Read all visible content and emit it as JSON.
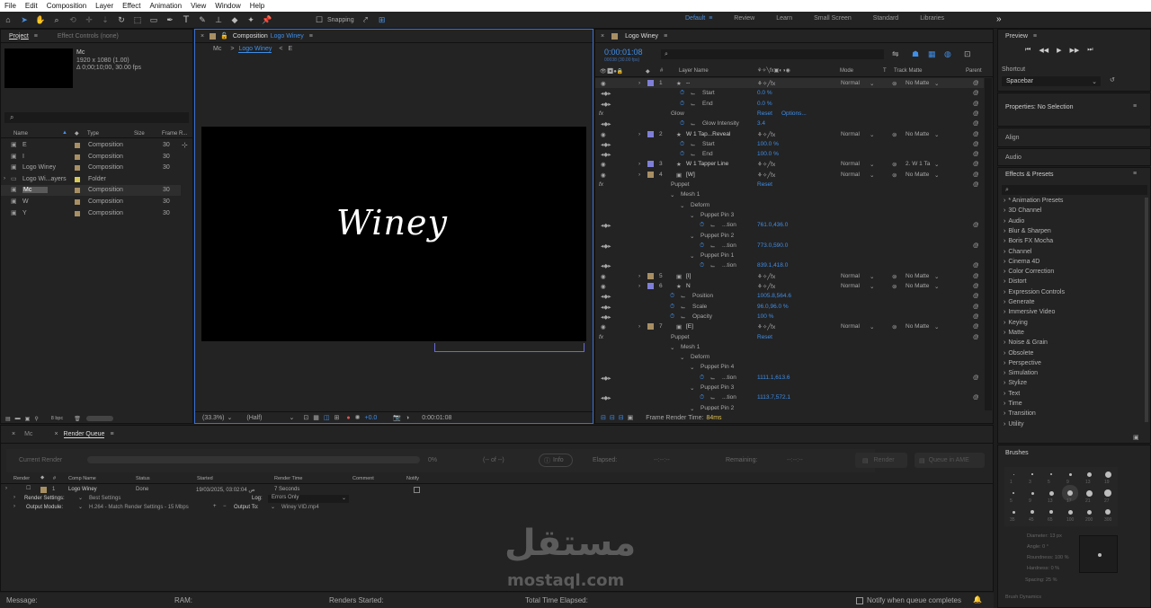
{
  "menu": [
    "File",
    "Edit",
    "Composition",
    "Layer",
    "Effect",
    "Animation",
    "View",
    "Window",
    "Help"
  ],
  "toolbar": {
    "snapping": "Snapping",
    "workspaces": [
      "Default",
      "Review",
      "Learn",
      "Small Screen",
      "Standard",
      "Libraries"
    ],
    "more": "»"
  },
  "project": {
    "tab": "Project",
    "tab_menu": "≡",
    "effect_controls": "Effect Controls (none)",
    "item_name": "Mc",
    "item_size": "1920 x 1080 (1.00)",
    "item_duration": "Δ 0;00;10;00, 30.00 fps",
    "search_icon": "⌕",
    "columns": [
      "Name",
      "Type",
      "Size",
      "Frame R..."
    ],
    "items": [
      {
        "name": "E",
        "type": "Composition",
        "fps": "30"
      },
      {
        "name": "I",
        "type": "Composition",
        "fps": "30"
      },
      {
        "name": "Logo Winey",
        "type": "Composition",
        "fps": "30"
      },
      {
        "name": "Logo Wi...ayers",
        "type": "Folder",
        "fps": ""
      },
      {
        "name": "Mc",
        "type": "Composition",
        "fps": "30"
      },
      {
        "name": "W",
        "type": "Composition",
        "fps": "30"
      },
      {
        "name": "Y",
        "type": "Composition",
        "fps": "30"
      }
    ],
    "bpc": "8 bpc"
  },
  "comp": {
    "tab_label": "Composition",
    "tab_name": "Logo Winey",
    "breadcrumb": [
      "Mc",
      "Logo Winey",
      "E"
    ],
    "logo_text": "Winey",
    "zoom": "(33.3%)",
    "quality": "(Half)",
    "exposure": "+0.0",
    "timecode": "0:00:01:08"
  },
  "timeline": {
    "tab": "Logo Winey",
    "time": "0:00:01:08",
    "frames": "00038 (30.00 fps)",
    "cols": [
      "#",
      "Layer Name",
      "Mode",
      "T",
      "Track Matte",
      "Parent"
    ],
    "render_time_label": "Frame Render Time:",
    "render_time_value": "84ms",
    "rows": [
      {
        "k": "layer",
        "num": "1",
        "name": "--",
        "mode": "Normal",
        "matte": "No Matte",
        "color": "#7f7fd8",
        "sel": true
      },
      {
        "k": "prop",
        "name": "Start",
        "val": "0.0 %",
        "ind": 2
      },
      {
        "k": "prop",
        "name": "End",
        "val": "0.0 %",
        "ind": 2
      },
      {
        "k": "fx",
        "name": "Glow",
        "val": "Reset",
        "extra": "Options..."
      },
      {
        "k": "prop",
        "name": "Glow Intensity",
        "val": "3.4",
        "ind": 2
      },
      {
        "k": "layer",
        "num": "2",
        "name": "W 1 Tap...Reveal",
        "mode": "Normal",
        "matte": "No Matte",
        "color": "#7f7fd8",
        "sel": false
      },
      {
        "k": "prop",
        "name": "Start",
        "val": "100.0 %",
        "ind": 2
      },
      {
        "k": "prop",
        "name": "End",
        "val": "100.0 %",
        "ind": 2
      },
      {
        "k": "layer",
        "num": "3",
        "name": "W 1 Tapper Line",
        "mode": "Normal",
        "matte": "2. W 1 Ta",
        "color": "#7f7fd8",
        "sel": false
      },
      {
        "k": "layer",
        "num": "4",
        "name": "[W]",
        "mode": "Normal",
        "matte": "No Matte",
        "color": "#a88f63",
        "sel": false
      },
      {
        "k": "fx",
        "name": "Puppet",
        "val": "Reset"
      },
      {
        "k": "group",
        "name": "Mesh 1",
        "ind": 1
      },
      {
        "k": "group",
        "name": "Deform",
        "ind": 2
      },
      {
        "k": "group",
        "name": "Puppet Pin 3",
        "ind": 3
      },
      {
        "k": "prop",
        "name": "...tion",
        "val": "761.0,436.0",
        "ind": 4
      },
      {
        "k": "group",
        "name": "Puppet Pin 2",
        "ind": 3
      },
      {
        "k": "prop",
        "name": "...tion",
        "val": "773.0,590.0",
        "ind": 4
      },
      {
        "k": "group",
        "name": "Puppet Pin 1",
        "ind": 3
      },
      {
        "k": "prop",
        "name": "...tion",
        "val": "839.1,418.0",
        "ind": 4
      },
      {
        "k": "layer",
        "num": "5",
        "name": "[I]",
        "mode": "Normal",
        "matte": "No Matte",
        "color": "#a88f63",
        "sel": false
      },
      {
        "k": "layer",
        "num": "6",
        "name": "N",
        "mode": "Normal",
        "matte": "No Matte",
        "color": "#7f7fd8",
        "sel": false
      },
      {
        "k": "prop",
        "name": "Position",
        "val": "1005.8,564.6",
        "ind": 1
      },
      {
        "k": "prop",
        "name": "Scale",
        "val": "96.0,96.0 %",
        "ind": 1
      },
      {
        "k": "prop",
        "name": "Opacity",
        "val": "100 %",
        "ind": 1
      },
      {
        "k": "layer",
        "num": "7",
        "name": "[E]",
        "mode": "Normal",
        "matte": "No Matte",
        "color": "#a88f63",
        "sel": false
      },
      {
        "k": "fx",
        "name": "Puppet",
        "val": "Reset"
      },
      {
        "k": "group",
        "name": "Mesh 1",
        "ind": 1
      },
      {
        "k": "group",
        "name": "Deform",
        "ind": 2
      },
      {
        "k": "group",
        "name": "Puppet Pin 4",
        "ind": 3
      },
      {
        "k": "prop",
        "name": "...tion",
        "val": "1111.1,613.6",
        "ind": 4
      },
      {
        "k": "group",
        "name": "Puppet Pin 3",
        "ind": 3
      },
      {
        "k": "prop",
        "name": "...tion",
        "val": "1113.7,572.1",
        "ind": 4
      },
      {
        "k": "group",
        "name": "Puppet Pin 2",
        "ind": 3
      }
    ]
  },
  "preview": {
    "title": "Preview",
    "shortcut_label": "Shortcut",
    "shortcut_value": "Spacebar"
  },
  "properties": {
    "title": "Properties: No Selection"
  },
  "align": "Align",
  "audio": "Audio",
  "effects": {
    "title": "Effects & Presets",
    "items": [
      "* Animation Presets",
      "3D Channel",
      "Audio",
      "Blur & Sharpen",
      "Boris FX Mocha",
      "Channel",
      "Cinema 4D",
      "Color Correction",
      "Distort",
      "Expression Controls",
      "Generate",
      "Immersive Video",
      "Keying",
      "Matte",
      "Noise & Grain",
      "Obsolete",
      "Perspective",
      "Simulation",
      "Stylize",
      "Text",
      "Time",
      "Transition",
      "Utility"
    ]
  },
  "brushes": {
    "title": "Brushes",
    "sizes": [
      "1",
      "3",
      "5",
      "9",
      "13",
      "19",
      "5",
      "9",
      "13",
      "17",
      "21",
      "27",
      "35",
      "45",
      "65",
      "100",
      "200",
      "300"
    ],
    "diameter": "Diameter: 13 px",
    "angle": "Angle: 0 °",
    "roundness": "Roundness: 100 %",
    "hardness": "Hardness: 0 %",
    "spacing": "Spacing: 25 %",
    "dynamics": "Brush Dynamics"
  },
  "render": {
    "tab_mc": "Mc",
    "tab_queue": "Render Queue",
    "current_render": "Current Render",
    "percent": "0%",
    "progress": 0,
    "of": "(-- of --)",
    "info": "Info",
    "elapsed": "Elapsed:",
    "elapsed_val": "--:--:--",
    "remaining": "Remaining:",
    "remaining_val": "--:--:--",
    "render_btn": "Render",
    "ame_btn": "Queue in AME",
    "columns": [
      "Render",
      "#",
      "Comp Name",
      "Status",
      "Started",
      "Render Time",
      "Comment",
      "Notify"
    ],
    "item": {
      "num": "1",
      "comp": "Logo Winey",
      "status": "Done",
      "started": "19/03/2025, 03:02:04 ص",
      "time": "7 Seconds"
    },
    "settings_label": "Render Settings:",
    "settings_value": "Best Settings",
    "log_label": "Log:",
    "log_value": "Errors Only",
    "module_label": "Output Module:",
    "module_value": "H.264 - Match Render Settings - 15 Mbps",
    "output_label": "Output To:",
    "output_value": "Winey VID.mp4"
  },
  "status": {
    "message": "Message:",
    "ram": "RAM:",
    "renders_started": "Renders Started:",
    "total_elapsed": "Total Time Elapsed:",
    "notify": "Notify when queue completes"
  },
  "watermark": {
    "ar": "مستقل",
    "url": "mostaql.com"
  }
}
